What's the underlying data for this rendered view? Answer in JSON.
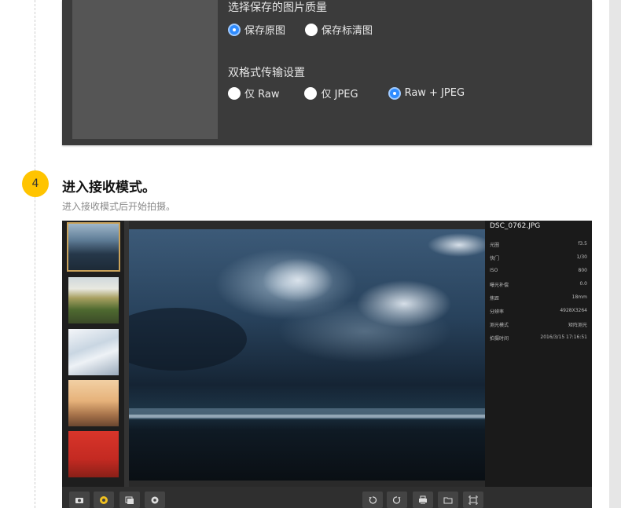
{
  "settings": {
    "quality_label": "选择保存的图片质量",
    "quality_options": [
      {
        "label": "保存原图",
        "selected": true
      },
      {
        "label": "保存标清图",
        "selected": false
      }
    ],
    "dual_label": "双格式传输设置",
    "dual_options": [
      {
        "label": "仅 Raw",
        "selected": false
      },
      {
        "label": "仅 JPEG",
        "selected": false
      },
      {
        "label": "Raw + JPEG",
        "selected": true
      }
    ]
  },
  "step": {
    "number": "4",
    "title": "进入接收模式。",
    "subtitle": "进入接收模式后开始拍摄。"
  },
  "app": {
    "filename": "DSC_0762.JPG",
    "info_rows": [
      {
        "key": "光圈",
        "value": "f3.5"
      },
      {
        "key": "快门",
        "value": "1/30"
      },
      {
        "key": "ISO",
        "value": "800"
      },
      {
        "key": "曝光补偿",
        "value": "0.0"
      },
      {
        "key": "焦距",
        "value": "18mm"
      },
      {
        "key": "分辨率",
        "value": "4928X3264"
      },
      {
        "key": "测光模式",
        "value": "矩阵测光"
      },
      {
        "key": "拍摄时间",
        "value": "2016/3/15 17:16:51"
      }
    ],
    "thumbnails": [
      "stormy-sea",
      "coast-cliff",
      "snow-landscape",
      "misty-trees",
      "red-wall-bicycle"
    ],
    "toolbar_left_icons": [
      "camera-icon",
      "logo-icon",
      "gallery-icon",
      "settings-icon"
    ],
    "toolbar_right_icons": [
      "rotate-left-icon",
      "rotate-right-icon",
      "print-icon",
      "folder-icon",
      "fullscreen-icon"
    ]
  },
  "colors": {
    "accent_blue": "#2f8cff",
    "step_yellow": "#ffc400",
    "panel_dark": "#3b3b3b"
  }
}
